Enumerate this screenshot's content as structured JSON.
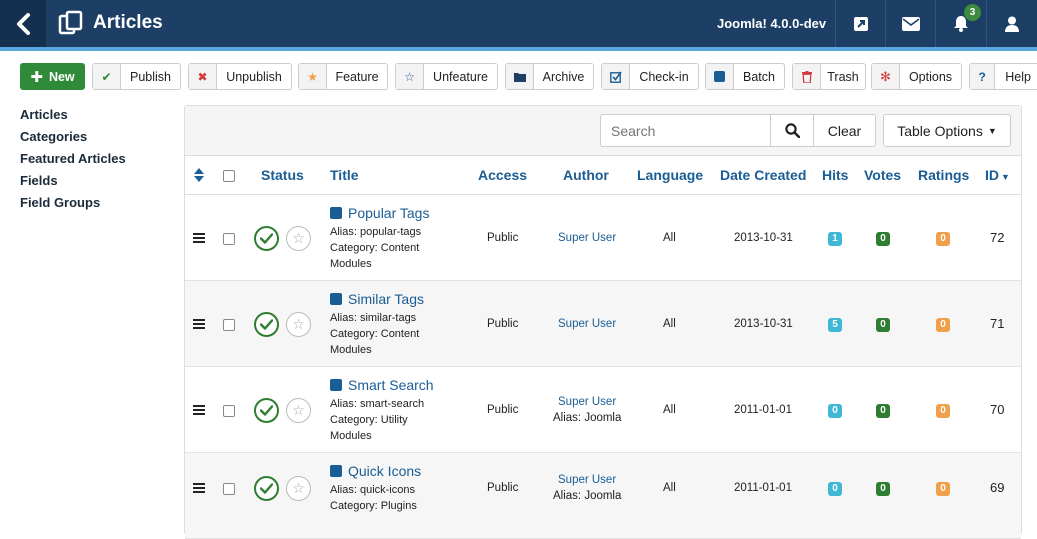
{
  "header": {
    "title": "Articles",
    "version": "Joomla! 4.0.0-dev",
    "notifications_count": "3",
    "icons": [
      "back-arrow-icon",
      "articles-icon",
      "external-link-icon",
      "mail-icon",
      "bell-icon",
      "user-icon"
    ]
  },
  "toolbar": {
    "new": "New",
    "publish": "Publish",
    "unpublish": "Unpublish",
    "feature": "Feature",
    "unfeature": "Unfeature",
    "archive": "Archive",
    "checkin": "Check-in",
    "batch": "Batch",
    "trash": "Trash",
    "options": "Options",
    "help": "Help"
  },
  "sidebar": {
    "items": [
      {
        "label": "Articles"
      },
      {
        "label": "Categories"
      },
      {
        "label": "Featured Articles"
      },
      {
        "label": "Fields"
      },
      {
        "label": "Field Groups"
      }
    ]
  },
  "filters": {
    "search_placeholder": "Search",
    "clear": "Clear",
    "table_options": "Table Options"
  },
  "table": {
    "columns": {
      "status": "Status",
      "title": "Title",
      "access": "Access",
      "author": "Author",
      "language": "Language",
      "date": "Date Created",
      "hits": "Hits",
      "votes": "Votes",
      "ratings": "Ratings",
      "id": "ID"
    },
    "rows": [
      {
        "title": "Popular Tags",
        "alias": "Alias: popular-tags",
        "category": "Category: Content",
        "category2": "Modules",
        "access": "Public",
        "author": "Super User",
        "author_alias": "",
        "language": "All",
        "date": "2013-10-31",
        "hits": "1",
        "votes": "0",
        "ratings": "0",
        "id": "72"
      },
      {
        "title": "Similar Tags",
        "alias": "Alias: similar-tags",
        "category": "Category: Content",
        "category2": "Modules",
        "access": "Public",
        "author": "Super User",
        "author_alias": "",
        "language": "All",
        "date": "2013-10-31",
        "hits": "5",
        "votes": "0",
        "ratings": "0",
        "id": "71"
      },
      {
        "title": "Smart Search",
        "alias": "Alias: smart-search",
        "category": "Category: Utility",
        "category2": "Modules",
        "access": "Public",
        "author": "Super User",
        "author_alias": "Alias: Joomla",
        "language": "All",
        "date": "2011-01-01",
        "hits": "0",
        "votes": "0",
        "ratings": "0",
        "id": "70"
      },
      {
        "title": "Quick Icons",
        "alias": "Alias: quick-icons",
        "category": "Category: Plugins",
        "category2": "",
        "access": "Public",
        "author": "Super User",
        "author_alias": "Alias: Joomla",
        "language": "All",
        "date": "2011-01-01",
        "hits": "0",
        "votes": "0",
        "ratings": "0",
        "id": "69"
      }
    ]
  },
  "colors": {
    "header": "#1d3f66",
    "accent": "#5aa6df",
    "new_button": "#2f8a3a",
    "link": "#1a5d94"
  }
}
